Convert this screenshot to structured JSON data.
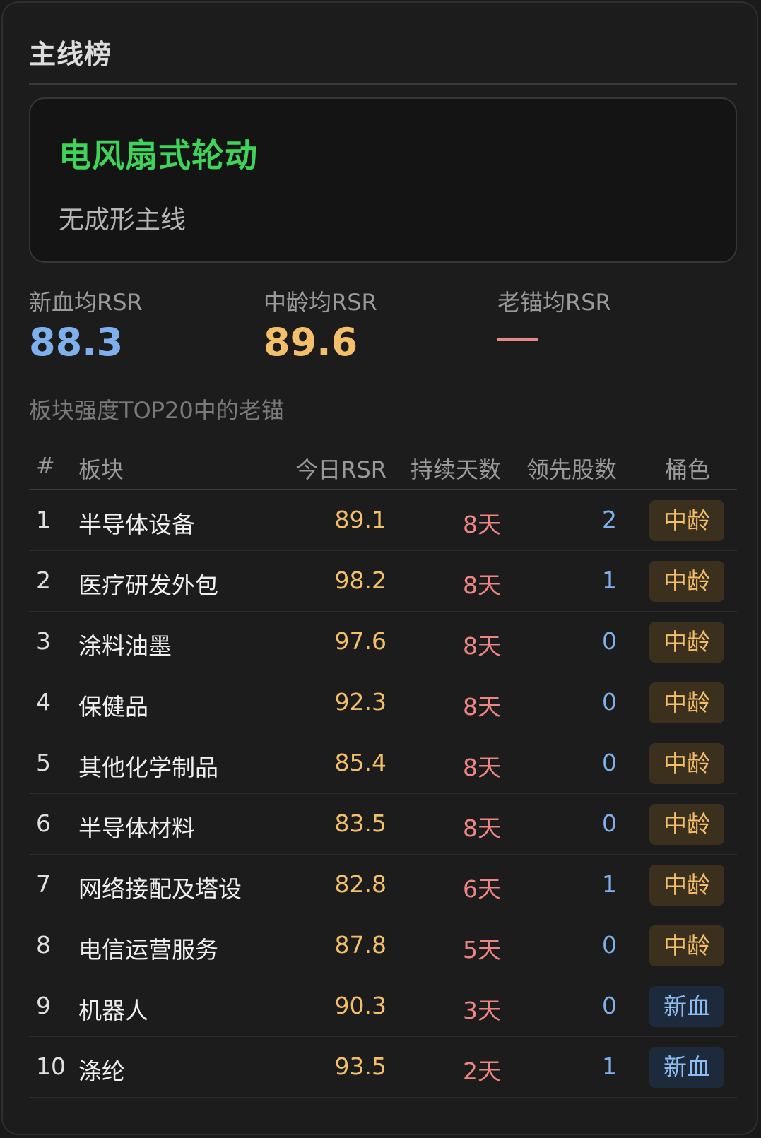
{
  "panel": {
    "title": "主线榜"
  },
  "summary": {
    "headline": "电风扇式轮动",
    "subtitle": "无成形主线"
  },
  "metrics": [
    {
      "label": "新血均RSR",
      "value": "88.3",
      "color": "#7fb0ee"
    },
    {
      "label": "中龄均RSR",
      "value": "89.6",
      "color": "#f4bf6a"
    },
    {
      "label": "老锚均RSR",
      "value": "—",
      "color": "#e58a8a"
    }
  ],
  "section_note": "板块强度TOP20中的老锚",
  "table": {
    "headers": {
      "rank": "#",
      "name": "板块",
      "rsr": "今日RSR",
      "days": "持续天数",
      "lead": "领先股数",
      "tag": "桶色"
    },
    "rows": [
      {
        "rank": "1",
        "name": "半导体设备",
        "rsr": "89.1",
        "days": "8天",
        "lead": "2",
        "tag": "中龄",
        "tag_kind": "mid"
      },
      {
        "rank": "2",
        "name": "医疗研发外包",
        "rsr": "98.2",
        "days": "8天",
        "lead": "1",
        "tag": "中龄",
        "tag_kind": "mid"
      },
      {
        "rank": "3",
        "name": "涂料油墨",
        "rsr": "97.6",
        "days": "8天",
        "lead": "0",
        "tag": "中龄",
        "tag_kind": "mid"
      },
      {
        "rank": "4",
        "name": "保健品",
        "rsr": "92.3",
        "days": "8天",
        "lead": "0",
        "tag": "中龄",
        "tag_kind": "mid"
      },
      {
        "rank": "5",
        "name": "其他化学制品",
        "rsr": "85.4",
        "days": "8天",
        "lead": "0",
        "tag": "中龄",
        "tag_kind": "mid"
      },
      {
        "rank": "6",
        "name": "半导体材料",
        "rsr": "83.5",
        "days": "8天",
        "lead": "0",
        "tag": "中龄",
        "tag_kind": "mid"
      },
      {
        "rank": "7",
        "name": "网络接配及塔设",
        "rsr": "82.8",
        "days": "6天",
        "lead": "1",
        "tag": "中龄",
        "tag_kind": "mid"
      },
      {
        "rank": "8",
        "name": "电信运营服务",
        "rsr": "87.8",
        "days": "5天",
        "lead": "0",
        "tag": "中龄",
        "tag_kind": "mid"
      },
      {
        "rank": "9",
        "name": "机器人",
        "rsr": "90.3",
        "days": "3天",
        "lead": "0",
        "tag": "新血",
        "tag_kind": "new"
      },
      {
        "rank": "10",
        "name": "涤纶",
        "rsr": "93.5",
        "days": "2天",
        "lead": "1",
        "tag": "新血",
        "tag_kind": "new"
      }
    ]
  },
  "colors": {
    "headline_green": "#3fd35a",
    "rsr_orange": "#f4bf6a",
    "days_red": "#ee8585",
    "lead_blue": "#7fb0ee",
    "tag_mid_bg": "#3b2f1d",
    "tag_new_bg": "#1d2a3b"
  }
}
